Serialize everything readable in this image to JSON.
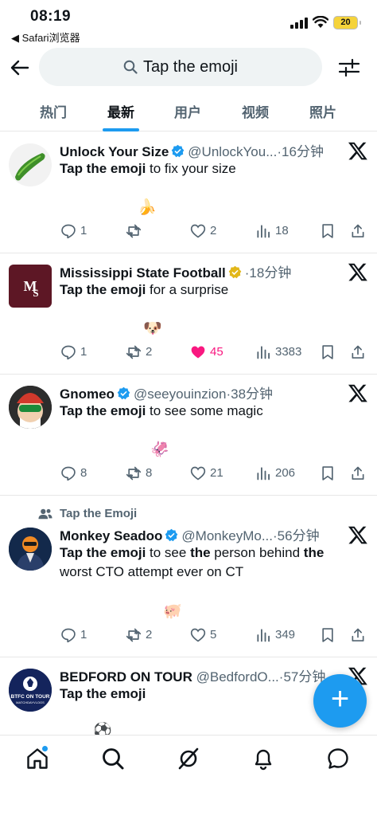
{
  "status_bar": {
    "time": "08:19",
    "back_app": "◀ Safari浏览器",
    "battery": "20"
  },
  "search": {
    "query": "Tap the emoji"
  },
  "tabs": [
    {
      "label": "热门"
    },
    {
      "label": "最新"
    },
    {
      "label": "用户"
    },
    {
      "label": "视频"
    },
    {
      "label": "照片"
    }
  ],
  "tweets": [
    {
      "name": "Unlock Your Size",
      "handle": "@UnlockYou...",
      "time": "·16分钟",
      "text_bold": "Tap the emoji",
      "text_rest": " to fix your size",
      "emoji": "🍌",
      "replies": "1",
      "retweets": "",
      "likes": "2",
      "views": "18"
    },
    {
      "name": "Mississippi State Football",
      "handle": "",
      "time": "·18分钟",
      "text_bold": "Tap the emoji",
      "text_rest": " for a surprise",
      "emoji": "🐶",
      "replies": "1",
      "retweets": "2",
      "likes": "45",
      "views": "3383"
    },
    {
      "name": "Gnomeo",
      "handle": "@seeyouinzion",
      "time": "·38分钟",
      "text_bold": "Tap the emoji",
      "text_rest": " to see some magic",
      "emoji": "🦑",
      "replies": "8",
      "retweets": "8",
      "likes": "21",
      "views": "206"
    },
    {
      "social_context": "Tap the Emoji",
      "name": "Monkey Seadoo",
      "handle": "@MonkeyMo...",
      "time": "·56分钟",
      "text_bold": "Tap the emoji",
      "text_rest_1": " to see ",
      "text_bold_2": "the",
      "text_rest_2": " person behind ",
      "text_bold_3": "the",
      "text_rest_3": " worst CTO attempt ever on CT",
      "emoji": "🐖",
      "replies": "1",
      "retweets": "2",
      "likes": "5",
      "views": "349"
    },
    {
      "name": "BEDFORD ON TOUR",
      "handle": "@BedfordO...",
      "time": "·57分钟",
      "text_bold": "Tap the emoji",
      "text_rest": "",
      "emoji": "⚽",
      "avatar_text_1": "BTFC ON TOUR",
      "avatar_text_2": "MATCHDAYVLOGS"
    }
  ],
  "fab": {
    "label": "+"
  },
  "colors": {
    "accent": "#1d9bf0",
    "like_active": "#f91880",
    "gold_badge": "#e2b719",
    "text_secondary": "#536471"
  },
  "icons": [
    "back-arrow-icon",
    "search-icon",
    "filter-icon",
    "verified-badge-icon",
    "x-logo-icon",
    "reply-icon",
    "retweet-icon",
    "like-icon",
    "views-icon",
    "bookmark-icon",
    "share-icon",
    "home-icon",
    "explore-icon",
    "grok-icon",
    "notifications-icon",
    "messages-icon",
    "community-icon"
  ]
}
